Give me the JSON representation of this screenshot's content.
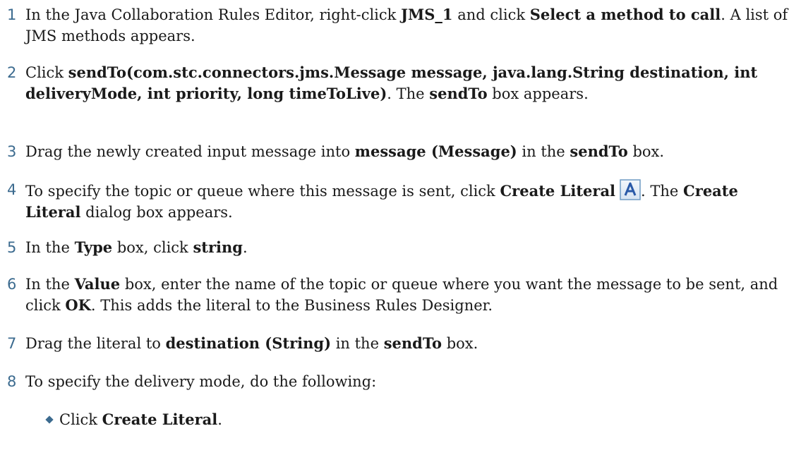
{
  "steps": [
    {
      "num": "1",
      "parts": [
        "In the Java Collaboration Rules Editor, right-click ",
        "JMS_1",
        " and click ",
        "Select a method to call",
        ". A list of JMS methods appears."
      ]
    },
    {
      "num": "2",
      "parts": [
        "Click ",
        "sendTo(com.stc.connectors.jms.Message message, java.lang.String destination, int deliveryMode, int priority, long timeToLive)",
        ". The ",
        "sendTo",
        " box appears."
      ]
    },
    {
      "num": "3",
      "parts": [
        "Drag the newly created input message into ",
        "message (Message)",
        " in the ",
        "sendTo",
        " box."
      ]
    },
    {
      "num": "4",
      "parts": [
        "To specify the topic or queue where this message is sent, click ",
        "Create Literal",
        ". The ",
        "Create Literal",
        " dialog box appears."
      ]
    },
    {
      "num": "5",
      "parts": [
        "In the ",
        "Type",
        " box, click ",
        "string",
        "."
      ]
    },
    {
      "num": "6",
      "parts": [
        "In the ",
        "Value",
        " box, enter the name of the topic or queue where you want the message to be sent, and click ",
        "OK",
        ". This adds the literal to the Business Rules Designer."
      ]
    },
    {
      "num": "7",
      "parts": [
        "Drag the literal to ",
        "destination (String)",
        " in the ",
        "sendTo",
        " box."
      ]
    },
    {
      "num": "8",
      "parts": [
        "To specify the delivery mode, do the following:"
      ]
    }
  ],
  "substeps": [
    {
      "parts": [
        "Click ",
        "Create Literal",
        "."
      ]
    }
  ],
  "icons": {
    "create_literal": "create-literal-icon"
  },
  "colors": {
    "step_number": "#3c6b8f",
    "icon_border": "#6f9bc4",
    "icon_letter": "#2a5aa8"
  }
}
